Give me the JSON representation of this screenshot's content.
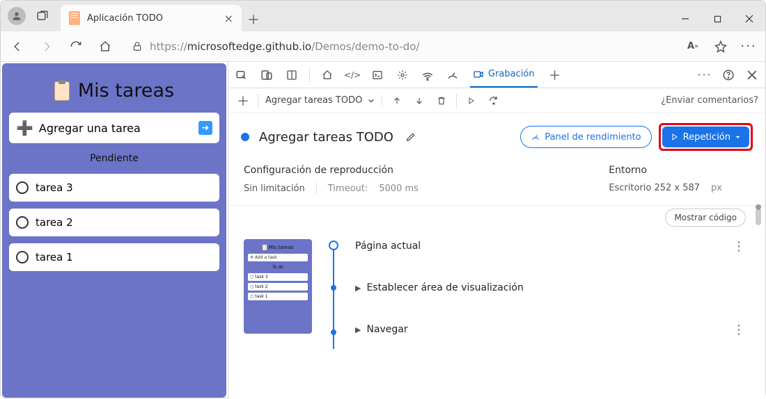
{
  "browser": {
    "tab_title": "Aplicación TODO",
    "url_prefix": "https://",
    "url_host": "microsoftedge.github.io",
    "url_path": "/Demos/demo-to-do/"
  },
  "app": {
    "title": "Mis tareas",
    "add_placeholder": "Agregar una tarea",
    "pending_label": "Pendiente",
    "tasks": [
      "tarea 3",
      "tarea 2",
      "tarea 1"
    ]
  },
  "devtools": {
    "active_tab": "Grabación",
    "toolbar_dropdown": "Agregar tareas TODO",
    "feedback": "¿Enviar comentarios?",
    "recording_title": "Agregar tareas TODO",
    "perf_button": "Panel de rendimiento",
    "replay_button": "Repetición",
    "settings": {
      "replay_header": "Configuración de reproducción",
      "throttle": "Sin limitación",
      "timeout_label": "Timeout:",
      "timeout_value": "5000 ms",
      "env_header": "Entorno",
      "env_value": "Escritorio 252 x 587",
      "env_unit": "px"
    },
    "show_code": "Mostrar código",
    "thumb": {
      "title": "Mis tareas",
      "add": "Add a task",
      "todo": "To do",
      "rows": [
        "task 3",
        "task 2",
        "task 1"
      ]
    },
    "steps": {
      "s1": "Página actual",
      "s2": "Establecer área de visualización",
      "s3": "Navegar"
    }
  }
}
